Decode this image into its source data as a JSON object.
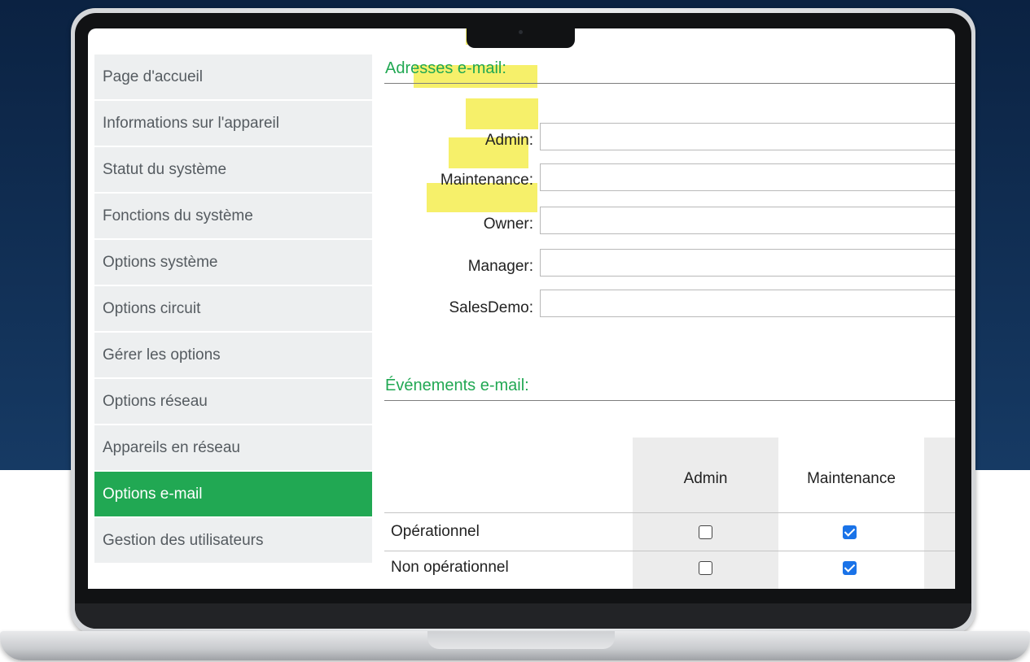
{
  "sidebar": {
    "items": [
      {
        "label": "Page d'accueil"
      },
      {
        "label": "Informations sur l'appareil"
      },
      {
        "label": "Statut du système"
      },
      {
        "label": "Fonctions du système"
      },
      {
        "label": "Options système"
      },
      {
        "label": "Options circuit"
      },
      {
        "label": "Gérer les options"
      },
      {
        "label": "Options réseau"
      },
      {
        "label": "Appareils en réseau"
      },
      {
        "label": "Options e-mail",
        "active": true
      },
      {
        "label": "Gestion des utilisateurs"
      }
    ]
  },
  "addresses": {
    "title": "Adresses e-mail:",
    "fields": [
      {
        "label": "Admin:",
        "value": ""
      },
      {
        "label": "Maintenance:",
        "value": ""
      },
      {
        "label": "Owner:",
        "value": ""
      },
      {
        "label": "Manager:",
        "value": ""
      },
      {
        "label": "SalesDemo:",
        "value": ""
      }
    ]
  },
  "events": {
    "title": "Événements e-mail:",
    "columns": [
      "Admin",
      "Maintenance"
    ],
    "rows": [
      {
        "label": "Opérationnel",
        "checked": [
          false,
          true
        ]
      },
      {
        "label": "Non opérationnel",
        "checked": [
          false,
          true
        ]
      }
    ]
  },
  "colors": {
    "accent": "#21a853",
    "highlight": "#f6f06a",
    "checkbox_checked": "#1a73e8",
    "background_top": "#0b2242"
  }
}
